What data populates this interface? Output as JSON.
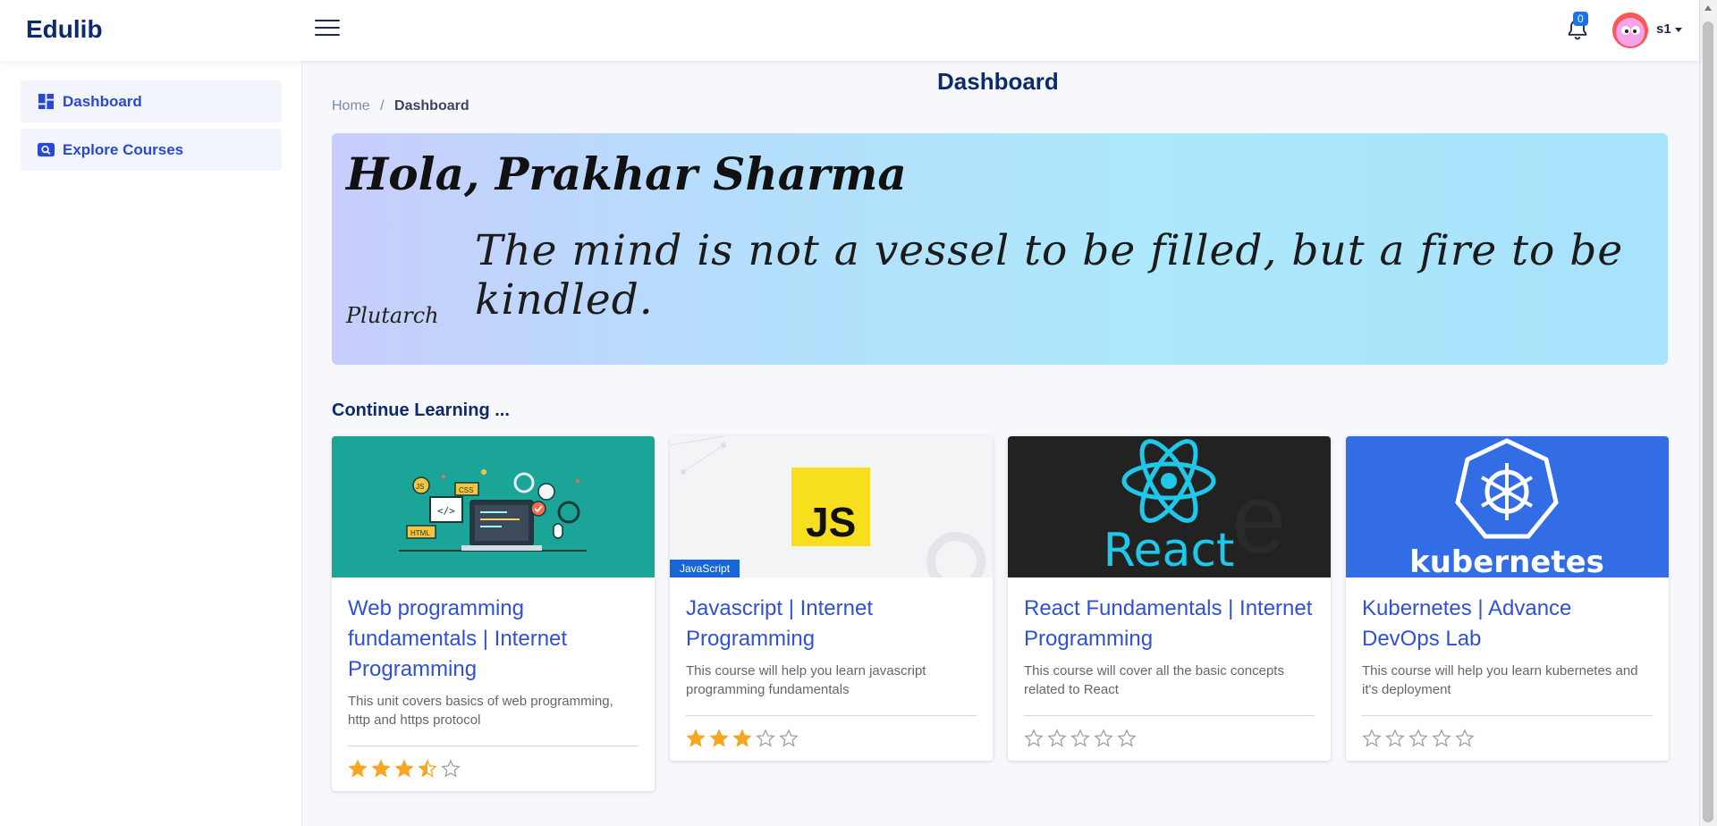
{
  "app": {
    "brand": "Edulib"
  },
  "navbar": {
    "menu_icon": "hamburger-icon",
    "notifications_count": "0",
    "user_name": "s1"
  },
  "sidebar": {
    "items": [
      {
        "label": "Dashboard",
        "icon": "dashboard-icon"
      },
      {
        "label": "Explore Courses",
        "icon": "search-icon"
      }
    ]
  },
  "page": {
    "title": "Dashboard",
    "breadcrumb": {
      "home": "Home",
      "separator": "/",
      "current": "Dashboard"
    }
  },
  "hero": {
    "greeting": "Hola, Prakhar Sharma",
    "quote": "The mind is not a vessel to be filled, but a fire to be kindled.",
    "author": "Plutarch"
  },
  "continue_learning": {
    "title": "Continue Learning ...",
    "courses": [
      {
        "title": "Web programming fundamentals | Internet Programming",
        "description": "This unit covers basics of web programming, http and https protocol",
        "rating": 3.5,
        "image": "web-programming-illustration",
        "color": "#1aa598"
      },
      {
        "title": "Javascript | Internet Programming",
        "description": "This course will help you learn javascript programming fundamentals",
        "rating": 3,
        "image": "javascript-logo",
        "tag": "JavaScript",
        "color": "#f3f4f6"
      },
      {
        "title": "React Fundamentals | Internet Programming",
        "description": "This course will cover all the basic concepts related to React",
        "rating": 0,
        "image": "react-logo",
        "image_text": "React",
        "color": "#222222"
      },
      {
        "title": "Kubernetes | Advance DevOps Lab",
        "description": "This course will help you learn kubernetes and it's deployment",
        "rating": 0,
        "image": "kubernetes-logo",
        "image_text": "kubernetes",
        "color": "#326de6"
      }
    ]
  },
  "colors": {
    "accent": "#3050d8",
    "brand": "#0d2b6b",
    "star_filled": "#f5a623",
    "star_empty": "#9aa0a6"
  }
}
